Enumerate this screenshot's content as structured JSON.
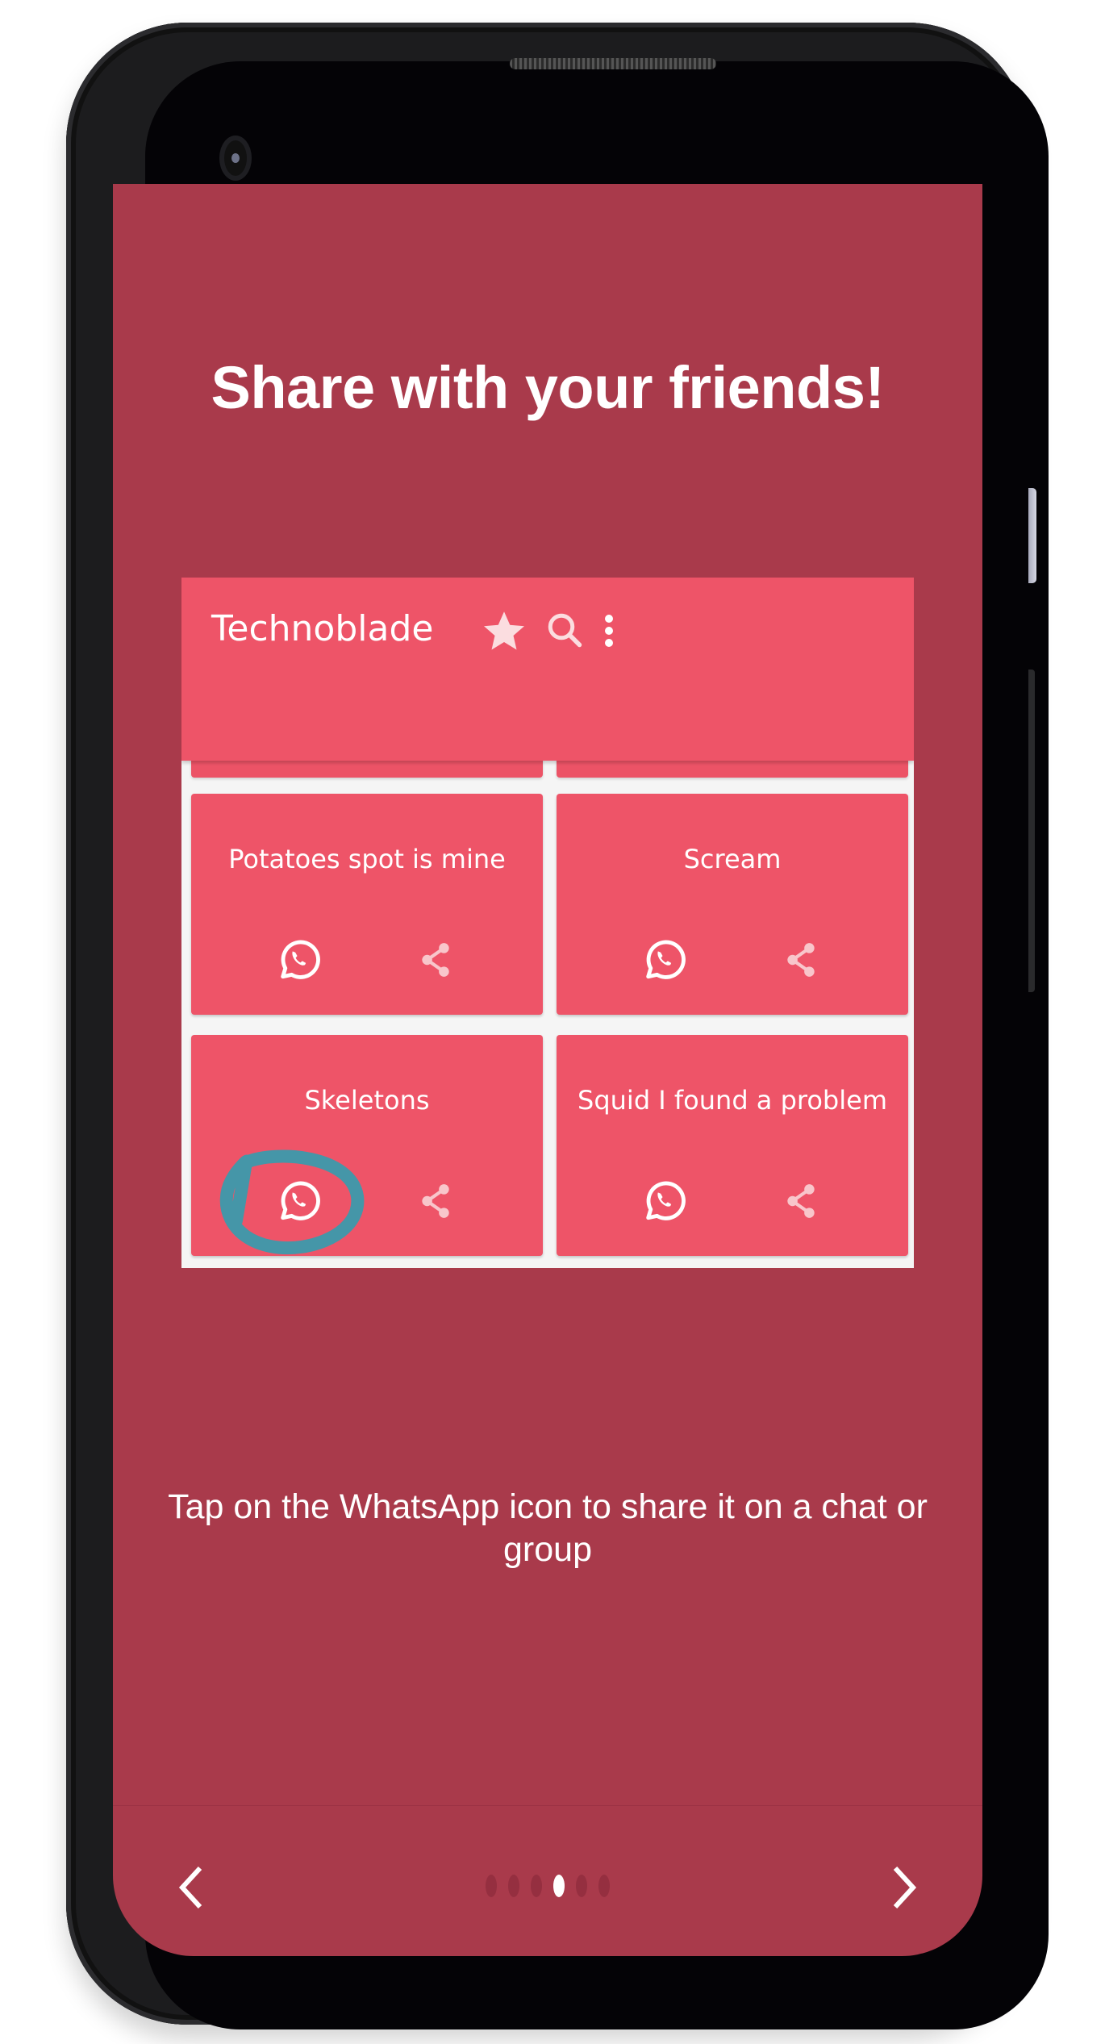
{
  "onboarding": {
    "headline": "Share with your friends!",
    "caption": "Tap on the WhatsApp icon to share it on a chat or group",
    "page_indicator": {
      "total": 6,
      "current": 4
    },
    "nav": {
      "prev_icon": "chevron-left-icon",
      "next_icon": "chevron-right-icon"
    }
  },
  "mockup": {
    "app_title": "Technoblade",
    "toolbar_icons": [
      "star-icon",
      "search-icon",
      "more-vert-icon"
    ],
    "cards": [
      {
        "title": "Potatoes spot is mine",
        "actions": [
          "whatsapp-icon",
          "share-icon"
        ]
      },
      {
        "title": "Scream",
        "actions": [
          "whatsapp-icon",
          "share-icon"
        ]
      },
      {
        "title": "Skeletons",
        "actions": [
          "whatsapp-icon",
          "share-icon"
        ],
        "highlighted_action": "whatsapp-icon"
      },
      {
        "title": "Squid I found a problem",
        "actions": [
          "whatsapp-icon",
          "share-icon"
        ]
      }
    ]
  },
  "colors": {
    "screen_bg": "#a93a4b",
    "app_primary": "#ee5468",
    "highlight_stroke": "#4596a8",
    "text": "#ffffff"
  }
}
